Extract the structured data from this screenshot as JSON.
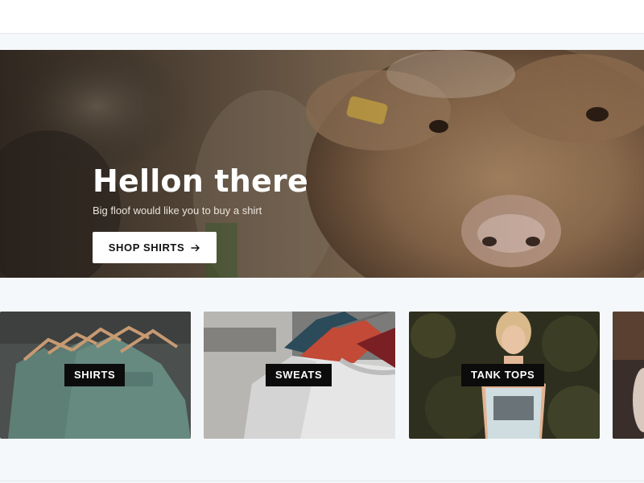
{
  "hero": {
    "title": "Hellon there",
    "subtitle": "Big floof would like you to buy a shirt",
    "button_label": "SHOP SHIRTS",
    "button_icon": "arrow-right-icon"
  },
  "categories": [
    {
      "label": "SHIRTS"
    },
    {
      "label": "SWEATS"
    },
    {
      "label": "TANK TOPS"
    }
  ],
  "colors": {
    "page_background": "#f5f8fb",
    "label_background": "#0c0c0c",
    "button_background": "#ffffff"
  }
}
